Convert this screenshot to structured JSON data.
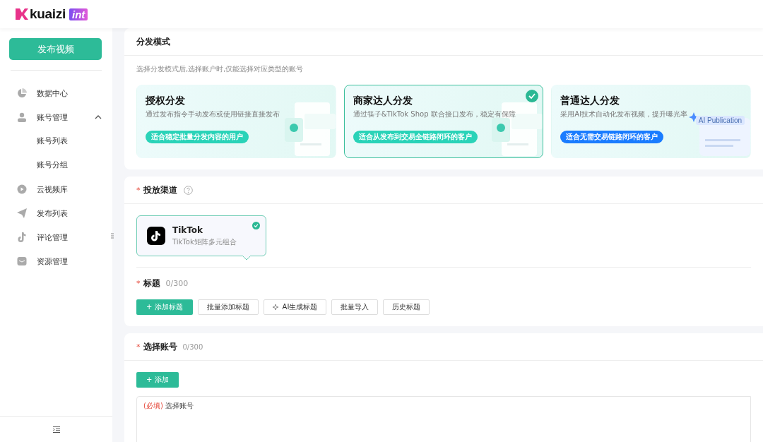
{
  "header": {
    "logo_text": "kuaizi",
    "logo_badge": "int"
  },
  "sidebar": {
    "publish_button": "发布视频",
    "items": [
      {
        "label": "数据中心"
      },
      {
        "label": "账号管理",
        "expanded": true,
        "children": [
          {
            "label": "账号列表"
          },
          {
            "label": "账号分组"
          }
        ]
      },
      {
        "label": "云视频库"
      },
      {
        "label": "发布列表"
      },
      {
        "label": "评论管理"
      },
      {
        "label": "资源管理"
      }
    ]
  },
  "mode_section": {
    "heading": "分发模式",
    "hint": "选择分发模式后,选择账户时,仅能选择对应类型的账号",
    "modes": [
      {
        "title": "授权分发",
        "description": "通过发布指令手动发布或使用链接直接发布",
        "tag": "适合稳定批量分发内容的用户",
        "color": "#2ad3b8",
        "selected": false
      },
      {
        "title": "商家达人分发",
        "description": "通过筷子&TikTok Shop 联合接口发布，稳定有保障",
        "tag": "适合从发布到交易全链路闭环的客户",
        "color": "#2ad3b8",
        "selected": true
      },
      {
        "title": "普通达人分发",
        "description": "采用AI技术自动化发布视频，提升曝光率",
        "tag": "适合无需交易链路闭环的客户",
        "color": "#1a7cff",
        "selected": false,
        "art_label": "AI Publication"
      }
    ]
  },
  "channel_section": {
    "required_mark": "*",
    "heading": "投放渠道",
    "channels": [
      {
        "name": "TikTok",
        "description": "TikTok矩阵多元组合",
        "selected": true
      }
    ]
  },
  "title_section": {
    "required_mark": "*",
    "heading": "标题",
    "count": "0/300",
    "buttons": [
      {
        "label": "+ 添加标题",
        "kind": "primary"
      },
      {
        "label": "批量添加标题",
        "kind": "default"
      },
      {
        "label": "AI生成标题",
        "kind": "ai"
      },
      {
        "label": "批量导入",
        "kind": "default"
      },
      {
        "label": "历史标题",
        "kind": "default"
      }
    ]
  },
  "account_section": {
    "required_mark": "*",
    "heading": "选择账号",
    "count": "0/300",
    "add_button": "+ 添加",
    "required_note": "(必填)",
    "placeholder": "选择账号"
  }
}
